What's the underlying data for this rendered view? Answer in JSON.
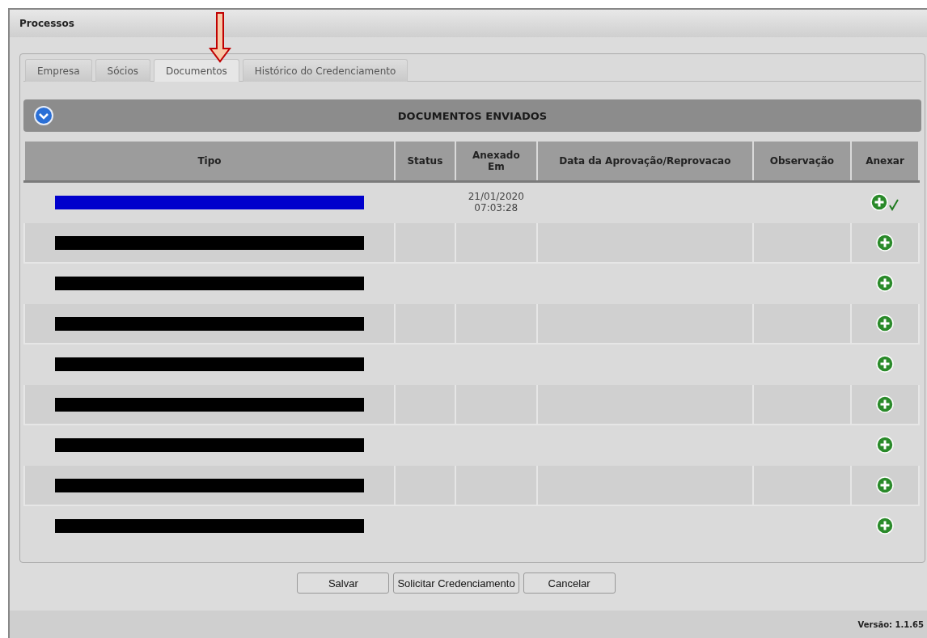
{
  "window": {
    "title": "Processos"
  },
  "tabs": [
    {
      "label": "Empresa",
      "selected": false
    },
    {
      "label": "Sócios",
      "selected": false
    },
    {
      "label": "Documentos",
      "selected": true
    },
    {
      "label": "Histórico do Credenciamento",
      "selected": false
    }
  ],
  "section": {
    "title": "DOCUMENTOS ENVIADOS",
    "expanded": true
  },
  "table": {
    "columns": [
      "Tipo",
      "Status",
      "Anexado Em",
      "Data da Aprovação/Reprovacao",
      "Observação",
      "Anexar"
    ],
    "rows": [
      {
        "color": "#0000cc",
        "attached_at": "21/01/2020 07:03:28",
        "attached": true
      },
      {
        "color": "#000000",
        "attached": false
      },
      {
        "color": "#000000",
        "attached": false
      },
      {
        "color": "#000000",
        "attached": false
      },
      {
        "color": "#000000",
        "attached": false
      },
      {
        "color": "#000000",
        "attached": false
      },
      {
        "color": "#000000",
        "attached": false
      },
      {
        "color": "#000000",
        "attached": false
      },
      {
        "color": "#000000",
        "attached": false
      }
    ]
  },
  "buttons": [
    "Salvar",
    "Solicitar Credenciamento",
    "Cancelar"
  ],
  "status_bar": {
    "version": "Versão: 1.1.65"
  }
}
